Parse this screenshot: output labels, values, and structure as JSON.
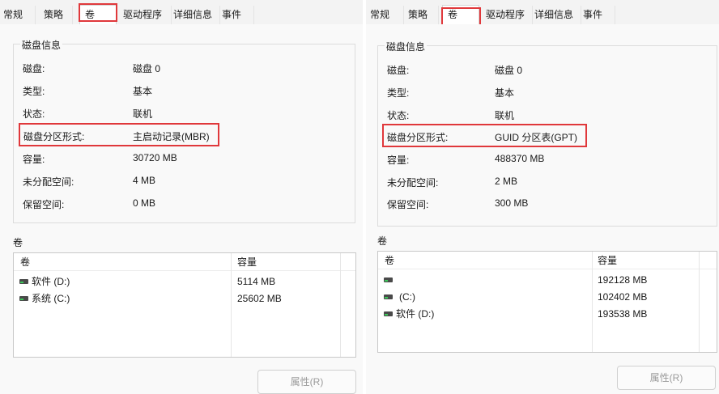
{
  "left": {
    "tabs": [
      "常规",
      "策略",
      "卷",
      "驱动程序",
      "详细信息",
      "事件"
    ],
    "disk_info": {
      "title": "磁盘信息",
      "props": [
        {
          "label": "磁盘:",
          "value": "磁盘 0"
        },
        {
          "label": "类型:",
          "value": "基本"
        },
        {
          "label": "状态:",
          "value": "联机"
        },
        {
          "label": "磁盘分区形式:",
          "value": "主启动记录(MBR)"
        },
        {
          "label": "容量:",
          "value": "30720 MB"
        },
        {
          "label": "未分配空间:",
          "value": "4 MB"
        },
        {
          "label": "保留空间:",
          "value": "0 MB"
        }
      ]
    },
    "volumes": {
      "section_label": "卷",
      "columns": [
        "卷",
        "容量"
      ],
      "rows": [
        {
          "name": "软件 (D:)",
          "capacity": "5114 MB"
        },
        {
          "name": "系统 (C:)",
          "capacity": "25602 MB"
        }
      ]
    },
    "properties_button": "属性(R)"
  },
  "right": {
    "tabs": [
      "常规",
      "策略",
      "卷",
      "驱动程序",
      "详细信息",
      "事件"
    ],
    "disk_info": {
      "title": "磁盘信息",
      "props": [
        {
          "label": "磁盘:",
          "value": "磁盘 0"
        },
        {
          "label": "类型:",
          "value": "基本"
        },
        {
          "label": "状态:",
          "value": "联机"
        },
        {
          "label": "磁盘分区形式:",
          "value": "GUID 分区表(GPT)"
        },
        {
          "label": "容量:",
          "value": "488370 MB"
        },
        {
          "label": "未分配空间:",
          "value": "2 MB"
        },
        {
          "label": "保留空间:",
          "value": "300 MB"
        }
      ]
    },
    "volumes": {
      "section_label": "卷",
      "columns": [
        "卷",
        "容量"
      ],
      "rows": [
        {
          "name": "",
          "capacity": "192128 MB"
        },
        {
          "name": "(C:)",
          "capacity": "102402 MB"
        },
        {
          "name": "软件 (D:)",
          "capacity": "193538 MB"
        }
      ]
    },
    "properties_button": "属性(R)"
  },
  "colors": {
    "highlight": "#e0383b",
    "drive_led": "#3cc85a"
  }
}
